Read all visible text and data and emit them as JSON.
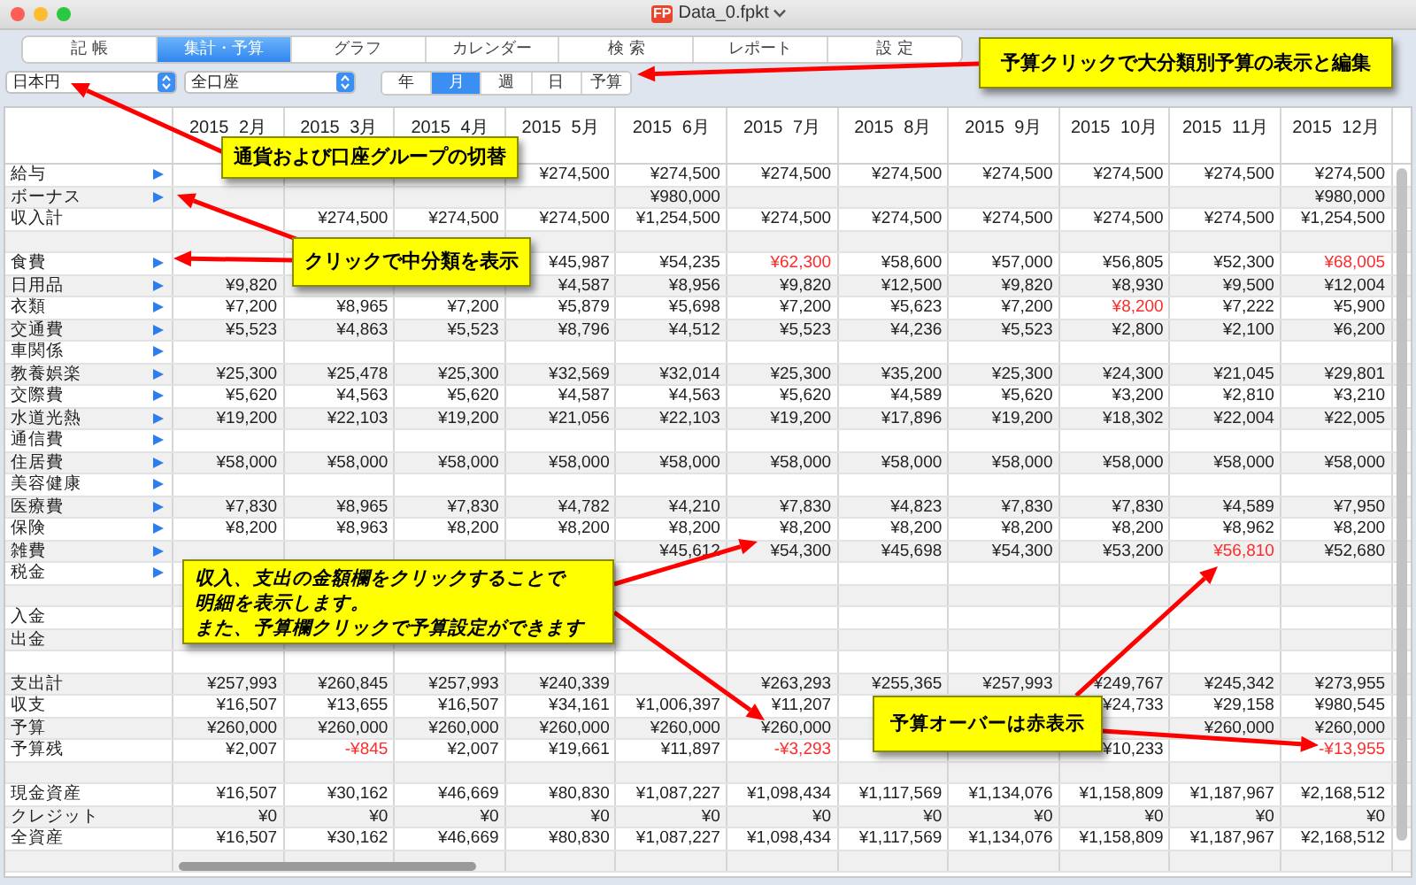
{
  "window": {
    "title": "Data_0.fpkt",
    "app_icon": "FP"
  },
  "tabs": [
    {
      "label": "記 帳",
      "selected": false
    },
    {
      "label": "集計・予算",
      "selected": true
    },
    {
      "label": "グラフ",
      "selected": false
    },
    {
      "label": "カレンダー",
      "selected": false
    },
    {
      "label": "検 索",
      "selected": false
    },
    {
      "label": "レポート",
      "selected": false
    },
    {
      "label": "設 定",
      "selected": false
    }
  ],
  "currency": {
    "value": "日本円"
  },
  "account_group": {
    "value": "全口座"
  },
  "periods": [
    {
      "label": "年",
      "selected": false
    },
    {
      "label": "月",
      "selected": true
    },
    {
      "label": "週",
      "selected": false
    },
    {
      "label": "日",
      "selected": false
    },
    {
      "label": "予算",
      "selected": false
    }
  ],
  "table": {
    "columns": [
      "2015 2月",
      "2015 3月",
      "2015 4月",
      "2015 5月",
      "2015 6月",
      "2015 7月",
      "2015 8月",
      "2015 9月",
      "2015 10月",
      "2015 11月",
      "2015 12月"
    ],
    "rows": [
      {
        "kind": "category",
        "label": "給与",
        "expandable": true,
        "cells": [
          null,
          null,
          null,
          {
            "text": "¥274,500",
            "over": false
          },
          {
            "text": "¥274,500",
            "over": false
          },
          {
            "text": "¥274,500",
            "over": false
          },
          {
            "text": "¥274,500",
            "over": false
          },
          {
            "text": "¥274,500",
            "over": false
          },
          {
            "text": "¥274,500",
            "over": false
          },
          {
            "text": "¥274,500",
            "over": false
          },
          {
            "text": "¥274,500",
            "over": false
          }
        ]
      },
      {
        "kind": "category",
        "label": "ボーナス",
        "expandable": true,
        "cells": [
          null,
          null,
          null,
          null,
          {
            "text": "¥980,000",
            "over": false
          },
          null,
          null,
          null,
          null,
          null,
          {
            "text": "¥980,000",
            "over": false
          }
        ]
      },
      {
        "kind": "category",
        "label": "収入計",
        "expandable": false,
        "cells": [
          null,
          {
            "text": "¥274,500",
            "over": false
          },
          {
            "text": "¥274,500",
            "over": false
          },
          {
            "text": "¥274,500",
            "over": false
          },
          {
            "text": "¥1,254,500",
            "over": false
          },
          {
            "text": "¥274,500",
            "over": false
          },
          {
            "text": "¥274,500",
            "over": false
          },
          {
            "text": "¥274,500",
            "over": false
          },
          {
            "text": "¥274,500",
            "over": false
          },
          {
            "text": "¥274,500",
            "over": false
          },
          {
            "text": "¥1,254,500",
            "over": false
          }
        ]
      },
      {
        "kind": "spacer"
      },
      {
        "kind": "category",
        "label": "食費",
        "expandable": true,
        "cells": [
          null,
          null,
          null,
          {
            "text": "¥45,987",
            "over": false
          },
          {
            "text": "¥54,235",
            "over": false
          },
          {
            "text": "¥62,300",
            "over": true
          },
          {
            "text": "¥58,600",
            "over": false
          },
          {
            "text": "¥57,000",
            "over": false
          },
          {
            "text": "¥56,805",
            "over": false
          },
          {
            "text": "¥52,300",
            "over": false
          },
          {
            "text": "¥68,005",
            "over": true
          }
        ]
      },
      {
        "kind": "category",
        "label": "日用品",
        "expandable": true,
        "cells": [
          {
            "text": "¥9,820",
            "over": false
          },
          null,
          null,
          {
            "text": "¥4,587",
            "over": false
          },
          {
            "text": "¥8,956",
            "over": false
          },
          {
            "text": "¥9,820",
            "over": false
          },
          {
            "text": "¥12,500",
            "over": false
          },
          {
            "text": "¥9,820",
            "over": false
          },
          {
            "text": "¥8,930",
            "over": false
          },
          {
            "text": "¥9,500",
            "over": false
          },
          {
            "text": "¥12,004",
            "over": false
          }
        ]
      },
      {
        "kind": "category",
        "label": "衣類",
        "expandable": true,
        "cells": [
          {
            "text": "¥7,200",
            "over": false
          },
          {
            "text": "¥8,965",
            "over": false
          },
          {
            "text": "¥7,200",
            "over": false
          },
          {
            "text": "¥5,879",
            "over": false
          },
          {
            "text": "¥5,698",
            "over": false
          },
          {
            "text": "¥7,200",
            "over": false
          },
          {
            "text": "¥5,623",
            "over": false
          },
          {
            "text": "¥7,200",
            "over": false
          },
          {
            "text": "¥8,200",
            "over": true
          },
          {
            "text": "¥7,222",
            "over": false
          },
          {
            "text": "¥5,900",
            "over": false
          }
        ]
      },
      {
        "kind": "category",
        "label": "交通費",
        "expandable": true,
        "cells": [
          {
            "text": "¥5,523",
            "over": false
          },
          {
            "text": "¥4,863",
            "over": false
          },
          {
            "text": "¥5,523",
            "over": false
          },
          {
            "text": "¥8,796",
            "over": false
          },
          {
            "text": "¥4,512",
            "over": false
          },
          {
            "text": "¥5,523",
            "over": false
          },
          {
            "text": "¥4,236",
            "over": false
          },
          {
            "text": "¥5,523",
            "over": false
          },
          {
            "text": "¥2,800",
            "over": false
          },
          {
            "text": "¥2,100",
            "over": false
          },
          {
            "text": "¥6,200",
            "over": false
          }
        ]
      },
      {
        "kind": "category",
        "label": "車関係",
        "expandable": true
      },
      {
        "kind": "category",
        "label": "教養娯楽",
        "expandable": true,
        "cells": [
          {
            "text": "¥25,300",
            "over": false
          },
          {
            "text": "¥25,478",
            "over": false
          },
          {
            "text": "¥25,300",
            "over": false
          },
          {
            "text": "¥32,569",
            "over": false
          },
          {
            "text": "¥32,014",
            "over": false
          },
          {
            "text": "¥25,300",
            "over": false
          },
          {
            "text": "¥35,200",
            "over": false
          },
          {
            "text": "¥25,300",
            "over": false
          },
          {
            "text": "¥24,300",
            "over": false
          },
          {
            "text": "¥21,045",
            "over": false
          },
          {
            "text": "¥29,801",
            "over": false
          }
        ]
      },
      {
        "kind": "category",
        "label": "交際費",
        "expandable": true,
        "cells": [
          {
            "text": "¥5,620",
            "over": false
          },
          {
            "text": "¥4,563",
            "over": false
          },
          {
            "text": "¥5,620",
            "over": false
          },
          {
            "text": "¥4,587",
            "over": false
          },
          {
            "text": "¥4,563",
            "over": false
          },
          {
            "text": "¥5,620",
            "over": false
          },
          {
            "text": "¥4,589",
            "over": false
          },
          {
            "text": "¥5,620",
            "over": false
          },
          {
            "text": "¥3,200",
            "over": false
          },
          {
            "text": "¥2,810",
            "over": false
          },
          {
            "text": "¥3,210",
            "over": false
          }
        ]
      },
      {
        "kind": "category",
        "label": "水道光熱",
        "expandable": true,
        "cells": [
          {
            "text": "¥19,200",
            "over": false
          },
          {
            "text": "¥22,103",
            "over": false
          },
          {
            "text": "¥19,200",
            "over": false
          },
          {
            "text": "¥21,056",
            "over": false
          },
          {
            "text": "¥22,103",
            "over": false
          },
          {
            "text": "¥19,200",
            "over": false
          },
          {
            "text": "¥17,896",
            "over": false
          },
          {
            "text": "¥19,200",
            "over": false
          },
          {
            "text": "¥18,302",
            "over": false
          },
          {
            "text": "¥22,004",
            "over": false
          },
          {
            "text": "¥22,005",
            "over": false
          }
        ]
      },
      {
        "kind": "category",
        "label": "通信費",
        "expandable": true
      },
      {
        "kind": "category",
        "label": "住居費",
        "expandable": true,
        "cells": [
          {
            "text": "¥58,000",
            "over": false
          },
          {
            "text": "¥58,000",
            "over": false
          },
          {
            "text": "¥58,000",
            "over": false
          },
          {
            "text": "¥58,000",
            "over": false
          },
          {
            "text": "¥58,000",
            "over": false
          },
          {
            "text": "¥58,000",
            "over": false
          },
          {
            "text": "¥58,000",
            "over": false
          },
          {
            "text": "¥58,000",
            "over": false
          },
          {
            "text": "¥58,000",
            "over": false
          },
          {
            "text": "¥58,000",
            "over": false
          },
          {
            "text": "¥58,000",
            "over": false
          }
        ]
      },
      {
        "kind": "category",
        "label": "美容健康",
        "expandable": true
      },
      {
        "kind": "category",
        "label": "医療費",
        "expandable": true,
        "cells": [
          {
            "text": "¥7,830",
            "over": false
          },
          {
            "text": "¥8,965",
            "over": false
          },
          {
            "text": "¥7,830",
            "over": false
          },
          {
            "text": "¥4,782",
            "over": false
          },
          {
            "text": "¥4,210",
            "over": false
          },
          {
            "text": "¥7,830",
            "over": false
          },
          {
            "text": "¥4,823",
            "over": false
          },
          {
            "text": "¥7,830",
            "over": false
          },
          {
            "text": "¥7,830",
            "over": false
          },
          {
            "text": "¥4,589",
            "over": false
          },
          {
            "text": "¥7,950",
            "over": false
          }
        ]
      },
      {
        "kind": "category",
        "label": "保険",
        "expandable": true,
        "cells": [
          {
            "text": "¥8,200",
            "over": false
          },
          {
            "text": "¥8,963",
            "over": false
          },
          {
            "text": "¥8,200",
            "over": false
          },
          {
            "text": "¥8,200",
            "over": false
          },
          {
            "text": "¥8,200",
            "over": false
          },
          {
            "text": "¥8,200",
            "over": false
          },
          {
            "text": "¥8,200",
            "over": false
          },
          {
            "text": "¥8,200",
            "over": false
          },
          {
            "text": "¥8,200",
            "over": false
          },
          {
            "text": "¥8,962",
            "over": false
          },
          {
            "text": "¥8,200",
            "over": false
          }
        ]
      },
      {
        "kind": "category",
        "label": "雑費",
        "expandable": true,
        "cells": [
          null,
          null,
          null,
          null,
          {
            "text": "¥45,612",
            "over": false
          },
          {
            "text": "¥54,300",
            "over": false
          },
          {
            "text": "¥45,698",
            "over": false
          },
          {
            "text": "¥54,300",
            "over": false
          },
          {
            "text": "¥53,200",
            "over": false
          },
          {
            "text": "¥56,810",
            "over": true
          },
          {
            "text": "¥52,680",
            "over": false
          }
        ]
      },
      {
        "kind": "category",
        "label": "税金",
        "expandable": true
      },
      {
        "kind": "spacer"
      },
      {
        "kind": "category",
        "label": "入金",
        "expandable": false
      },
      {
        "kind": "category",
        "label": "出金",
        "expandable": false
      },
      {
        "kind": "spacer"
      },
      {
        "kind": "category",
        "label": "支出計",
        "expandable": false,
        "cells": [
          {
            "text": "¥257,993",
            "over": false
          },
          {
            "text": "¥260,845",
            "over": false
          },
          {
            "text": "¥257,993",
            "over": false
          },
          {
            "text": "¥240,339",
            "over": false
          },
          null,
          {
            "text": "¥263,293",
            "over": false
          },
          {
            "text": "¥255,365",
            "over": false
          },
          {
            "text": "¥257,993",
            "over": false
          },
          {
            "text": "¥249,767",
            "over": false
          },
          {
            "text": "¥245,342",
            "over": false
          },
          {
            "text": "¥273,955",
            "over": false
          }
        ]
      },
      {
        "kind": "category",
        "label": "収支",
        "expandable": false,
        "cells": [
          {
            "text": "¥16,507",
            "over": false
          },
          {
            "text": "¥13,655",
            "over": false
          },
          {
            "text": "¥16,507",
            "over": false
          },
          {
            "text": "¥34,161",
            "over": false
          },
          {
            "text": "¥1,006,397",
            "over": false
          },
          {
            "text": "¥11,207",
            "over": false
          },
          null,
          null,
          {
            "text": "¥24,733",
            "over": false
          },
          {
            "text": "¥29,158",
            "over": false
          },
          {
            "text": "¥980,545",
            "over": false
          }
        ]
      },
      {
        "kind": "category",
        "label": "予算",
        "expandable": false,
        "cells": [
          {
            "text": "¥260,000",
            "over": false
          },
          {
            "text": "¥260,000",
            "over": false
          },
          {
            "text": "¥260,000",
            "over": false
          },
          {
            "text": "¥260,000",
            "over": false
          },
          {
            "text": "¥260,000",
            "over": false
          },
          {
            "text": "¥260,000",
            "over": false
          },
          null,
          null,
          null,
          {
            "text": "¥260,000",
            "over": false
          },
          {
            "text": "¥260,000",
            "over": false
          }
        ]
      },
      {
        "kind": "category",
        "label": "予算残",
        "expandable": false,
        "cells": [
          {
            "text": "¥2,007",
            "over": false
          },
          {
            "text": "-¥845",
            "over": true
          },
          {
            "text": "¥2,007",
            "over": false
          },
          {
            "text": "¥19,661",
            "over": false
          },
          {
            "text": "¥11,897",
            "over": false
          },
          {
            "text": "-¥3,293",
            "over": true
          },
          null,
          null,
          {
            "text": "¥10,233",
            "over": false
          },
          null,
          {
            "text": "-¥13,955",
            "over": true
          }
        ]
      },
      {
        "kind": "spacer"
      },
      {
        "kind": "category",
        "label": "現金資産",
        "expandable": false,
        "cells": [
          {
            "text": "¥16,507",
            "over": false
          },
          {
            "text": "¥30,162",
            "over": false
          },
          {
            "text": "¥46,669",
            "over": false
          },
          {
            "text": "¥80,830",
            "over": false
          },
          {
            "text": "¥1,087,227",
            "over": false
          },
          {
            "text": "¥1,098,434",
            "over": false
          },
          {
            "text": "¥1,117,569",
            "over": false
          },
          {
            "text": "¥1,134,076",
            "over": false
          },
          {
            "text": "¥1,158,809",
            "over": false
          },
          {
            "text": "¥1,187,967",
            "over": false
          },
          {
            "text": "¥2,168,512",
            "over": false
          }
        ]
      },
      {
        "kind": "category",
        "label": "クレジット",
        "expandable": false,
        "cells": [
          {
            "text": "¥0",
            "over": false
          },
          {
            "text": "¥0",
            "over": false
          },
          {
            "text": "¥0",
            "over": false
          },
          {
            "text": "¥0",
            "over": false
          },
          {
            "text": "¥0",
            "over": false
          },
          {
            "text": "¥0",
            "over": false
          },
          {
            "text": "¥0",
            "over": false
          },
          {
            "text": "¥0",
            "over": false
          },
          {
            "text": "¥0",
            "over": false
          },
          {
            "text": "¥0",
            "over": false
          },
          {
            "text": "¥0",
            "over": false
          }
        ]
      },
      {
        "kind": "category",
        "label": "全資産",
        "expandable": false,
        "cells": [
          {
            "text": "¥16,507",
            "over": false
          },
          {
            "text": "¥30,162",
            "over": false
          },
          {
            "text": "¥46,669",
            "over": false
          },
          {
            "text": "¥80,830",
            "over": false
          },
          {
            "text": "¥1,087,227",
            "over": false
          },
          {
            "text": "¥1,098,434",
            "over": false
          },
          {
            "text": "¥1,117,569",
            "over": false
          },
          {
            "text": "¥1,134,076",
            "over": false
          },
          {
            "text": "¥1,158,809",
            "over": false
          },
          {
            "text": "¥1,187,967",
            "over": false
          },
          {
            "text": "¥2,168,512",
            "over": false
          }
        ]
      },
      {
        "kind": "spacer"
      }
    ]
  },
  "callouts": [
    {
      "text": "予算クリックで大分類別予算の表示と編集"
    },
    {
      "text": "通貨および口座グループの切替"
    },
    {
      "text": "クリックで中分類を表示"
    },
    {
      "lines": [
        "収入、支出の金額欄をクリックすることで",
        "明細を表示します。",
        "また、予算欄クリックで予算設定ができます"
      ]
    },
    {
      "text": "予算オーバーは赤表示"
    }
  ]
}
